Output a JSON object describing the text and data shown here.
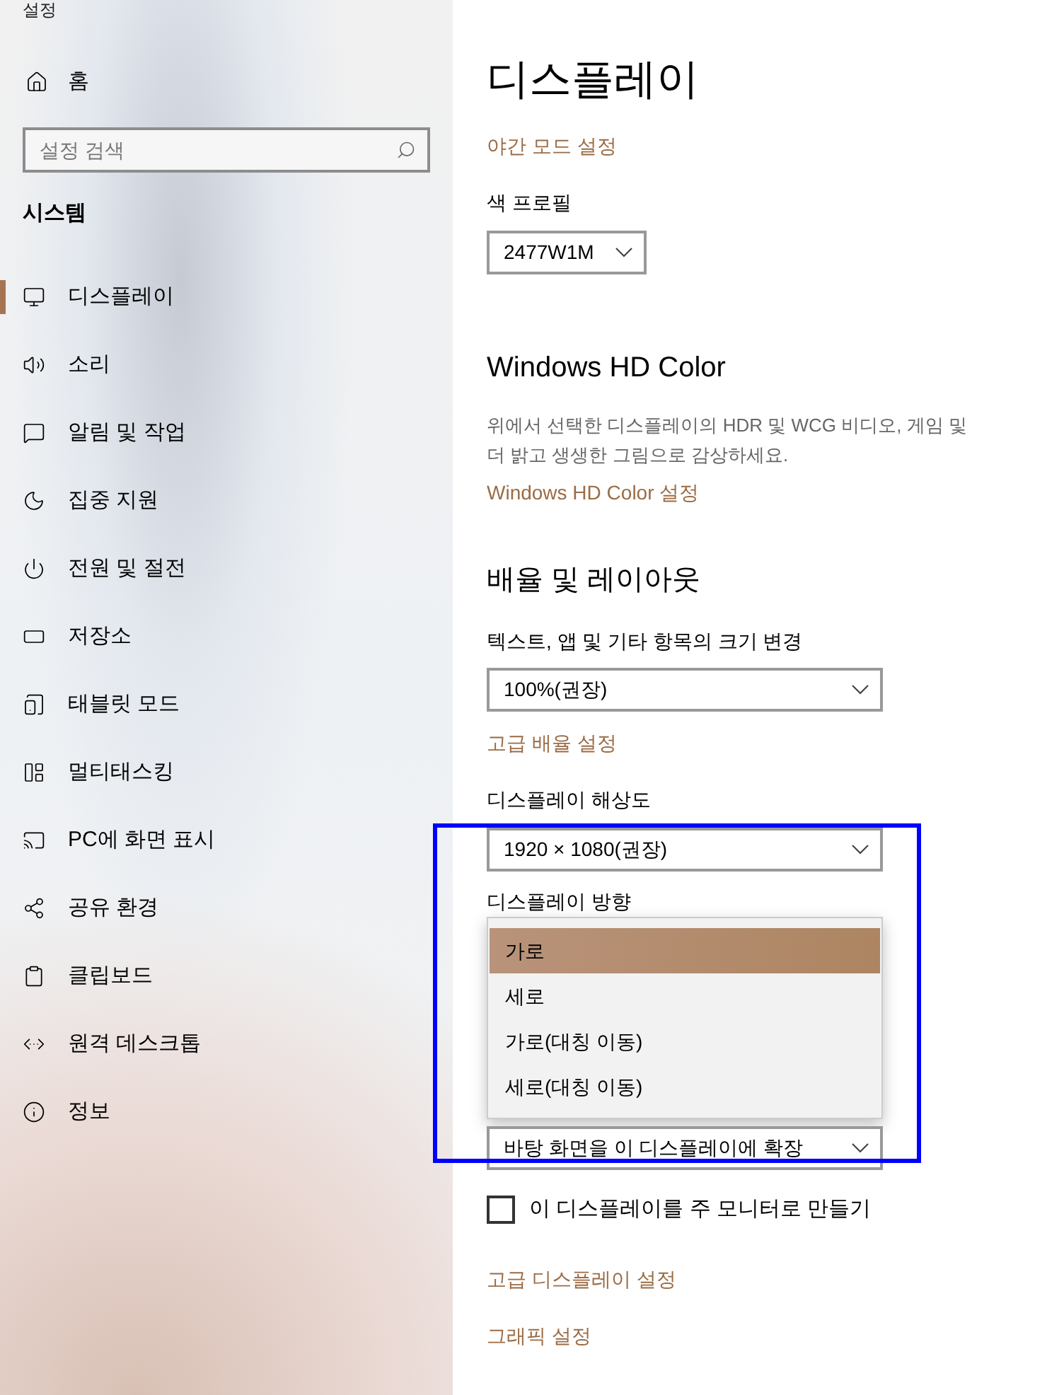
{
  "window": {
    "title": "설정"
  },
  "sidebar": {
    "home": "홈",
    "search": {
      "placeholder": "설정 검색"
    },
    "section": "시스템",
    "items": [
      {
        "label": "디스플레이",
        "selected": true
      },
      {
        "label": "소리",
        "selected": false
      },
      {
        "label": "알림 및 작업",
        "selected": false
      },
      {
        "label": "집중 지원",
        "selected": false
      },
      {
        "label": "전원 및 절전",
        "selected": false
      },
      {
        "label": "저장소",
        "selected": false
      },
      {
        "label": "태블릿 모드",
        "selected": false
      },
      {
        "label": "멀티태스킹",
        "selected": false
      },
      {
        "label": "PC에 화면 표시",
        "selected": false
      },
      {
        "label": "공유 환경",
        "selected": false
      },
      {
        "label": "클립보드",
        "selected": false
      },
      {
        "label": "원격 데스크톱",
        "selected": false
      },
      {
        "label": "정보",
        "selected": false
      }
    ]
  },
  "content": {
    "page_title": "디스플레이",
    "night_link": "야간 모드 설정",
    "color_profile": {
      "label": "색 프로필",
      "value": "2477W1M"
    },
    "hd_color": {
      "heading": "Windows HD Color",
      "description_lines": [
        "위에서 선택한 디스플레이의 HDR 및 WCG 비디오, 게임 및",
        "더 밝고 생생한 그림으로 감상하세요."
      ],
      "link": "Windows HD Color 설정"
    },
    "scale_layout": {
      "heading": "배율 및 레이아웃",
      "scale": {
        "label": "텍스트, 앱 및 기타 항목의 크기 변경",
        "value": "100%(권장)"
      },
      "advanced_link": "고급 배율 설정",
      "resolution": {
        "label": "디스플레이 해상도",
        "value": "1920 × 1080(권장)"
      },
      "orientation": {
        "label": "디스플레이 방향",
        "options": [
          {
            "label": "가로",
            "selected": true
          },
          {
            "label": "세로",
            "selected": false
          },
          {
            "label": "가로(대칭 이동)",
            "selected": false
          },
          {
            "label": "세로(대칭 이동)",
            "selected": false
          }
        ]
      },
      "multi_display": {
        "value": "바탕 화면을 이 디스플레이에 확장"
      },
      "primary_checkbox": {
        "label": "이 디스플레이를 주 모니터로 만들기",
        "checked": false
      }
    },
    "links": [
      "고급 디스플레이 설정",
      "그래픽 설정"
    ]
  }
}
